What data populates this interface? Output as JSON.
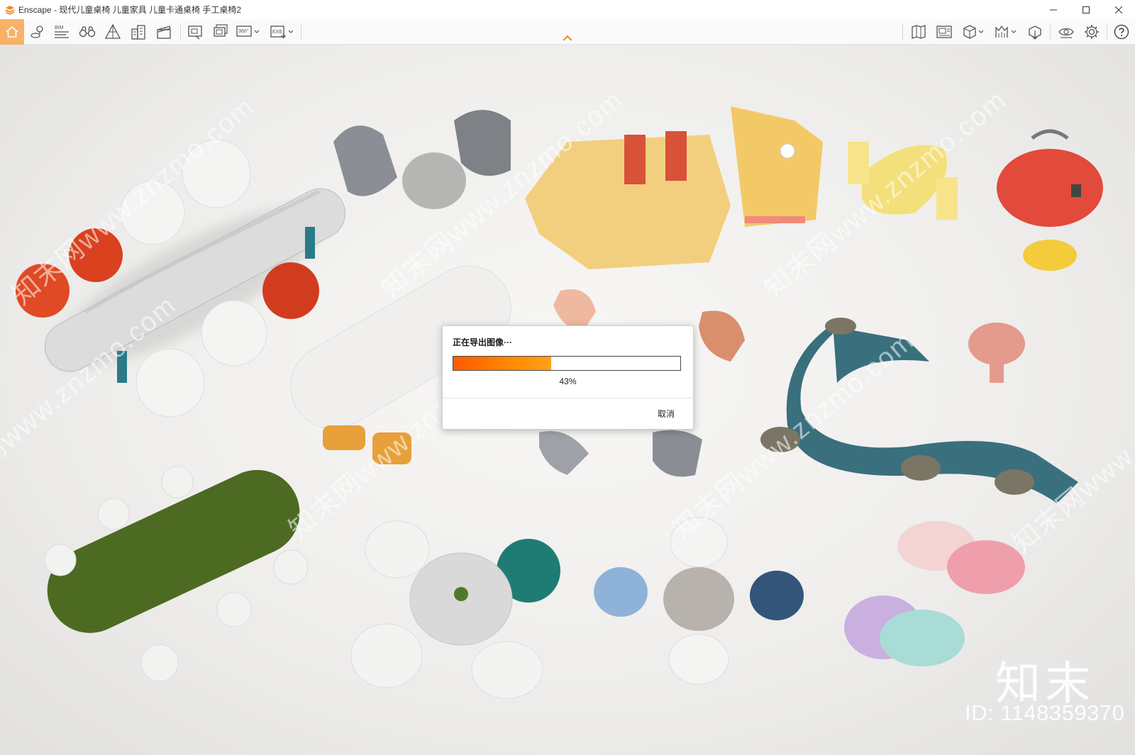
{
  "window": {
    "title": "Enscape - 现代儿童桌椅 儿童家具 儿童卡通桌椅 手工桌椅2",
    "accent_color": "#f7b267"
  },
  "toolbar": {
    "icons": [
      "home-icon",
      "location-pin-icon",
      "bim-icon",
      "binoculars-icon",
      "perspective-icon",
      "buildings-icon",
      "clapperboard-icon",
      "screenshot-icon",
      "batch-render-icon",
      "panorama-360-icon",
      "export-exe-icon",
      "map-icon",
      "image-panel-icon",
      "asset-library-icon",
      "site-context-icon",
      "export-icon",
      "eye-icon",
      "gear-icon",
      "help-icon"
    ],
    "bim_label": "BIM",
    "panorama_label": "360°",
    "exe_label": "EXE"
  },
  "dialog": {
    "title": "正在导出图像···",
    "progress_percent": 43,
    "progress_text": "43%",
    "cancel_label": "取消",
    "progress_color": "#ff7a00"
  },
  "render": {
    "watermark_text": "知末网www.znzmo.com",
    "brand_logo": "知末",
    "brand_id": "ID: 1148359370"
  }
}
